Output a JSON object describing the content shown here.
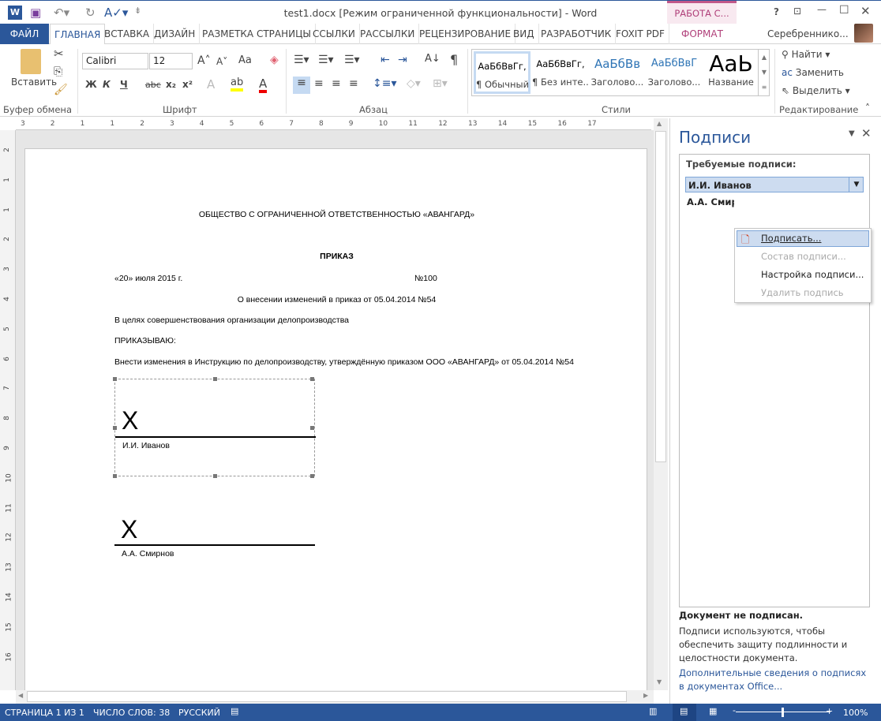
{
  "window": {
    "title": "test1.docx [Режим ограниченной функциональности] - Word",
    "context_group": "РАБОТА С...",
    "user": "Серебреннико...",
    "help": "?"
  },
  "tabs": [
    "ФАЙЛ",
    "ГЛАВНАЯ",
    "ВСТАВКА",
    "ДИЗАЙН",
    "РАЗМЕТКА СТРАНИЦЫ",
    "ССЫЛКИ",
    "РАССЫЛКИ",
    "РЕЦЕНЗИРОВАНИЕ",
    "ВИД",
    "РАЗРАБОТЧИК",
    "FOXIT PDF",
    "ФОРМАТ"
  ],
  "ribbon": {
    "clipboard": {
      "label": "Буфер обмена",
      "paste": "Вставить"
    },
    "font": {
      "label": "Шрифт",
      "name": "Calibri",
      "size": "12",
      "bold": "Ж",
      "italic": "К",
      "underline": "Ч",
      "strike": "abc",
      "sub": "x₂",
      "sup": "x²",
      "case": "Aa"
    },
    "paragraph": {
      "label": "Абзац",
      "pilcrow": "¶"
    },
    "styles": {
      "label": "Стили",
      "items": [
        {
          "sample": "АаБбВвГг,",
          "name": "¶ Обычный"
        },
        {
          "sample": "АаБбВвГг,",
          "name": "¶ Без инте..."
        },
        {
          "sample": "АаБбВв",
          "name": "Заголово..."
        },
        {
          "sample": "АаБбВвГ",
          "name": "Заголово..."
        },
        {
          "sample": "АаЬ",
          "name": "Название"
        }
      ]
    },
    "editing": {
      "label": "Редактирование",
      "find": "Найти",
      "replace": "Заменить",
      "select": "Выделить"
    }
  },
  "document": {
    "org": "ОБЩЕСТВО С ОГРАНИЧЕННОЙ ОТВЕТСТВЕННОСТЬЮ «АВАНГАРД»",
    "heading": "ПРИКАЗ",
    "date": "«20» июля 2015 г.",
    "number": "№100",
    "subject": "О внесении изменений в приказ от 05.04.2014 №54",
    "p1": "В целях совершенствования организации делопроизводства",
    "p2": "ПРИКАЗЫВАЮ:",
    "p3": "Внести изменения в Инструкцию по делопроизводству, утверждённую приказом ООО «АВАНГАРД» от 05.04.2014 №54",
    "signatures": [
      {
        "mark": "X",
        "name": "И.И. Иванов"
      },
      {
        "mark": "X",
        "name": "А.А. Смирнов"
      }
    ]
  },
  "ruler": {
    "h": [
      "3",
      "2",
      "1",
      "1",
      "2",
      "3",
      "4",
      "5",
      "6",
      "7",
      "8",
      "9",
      "10",
      "11",
      "12",
      "13",
      "14",
      "15",
      "16",
      "17"
    ],
    "v": [
      "2",
      "1",
      "1",
      "2",
      "3",
      "4",
      "5",
      "6",
      "7",
      "8",
      "9",
      "10",
      "11",
      "12",
      "13",
      "14",
      "15",
      "16"
    ]
  },
  "pane": {
    "title": "Подписи",
    "required": "Требуемые подписи:",
    "selected": "И.И. Иванов",
    "second": "А.А. Смирнов",
    "menu": [
      {
        "label": "Подписать...",
        "enabled": true
      },
      {
        "label": "Состав подписи...",
        "enabled": false
      },
      {
        "label": "Настройка подписи...",
        "enabled": true
      },
      {
        "label": "Удалить подпись",
        "enabled": false
      }
    ],
    "status_title": "Документ не подписан.",
    "status_text": "Подписи используются, чтобы обеспечить защиту подлинности и целостности документа.",
    "link": "Дополнительные сведения о подписях в документах Office..."
  },
  "status": {
    "page": "СТРАНИЦА 1 ИЗ 1",
    "words": "ЧИСЛО СЛОВ: 38",
    "lang": "РУССКИЙ",
    "zoom": "100%"
  }
}
